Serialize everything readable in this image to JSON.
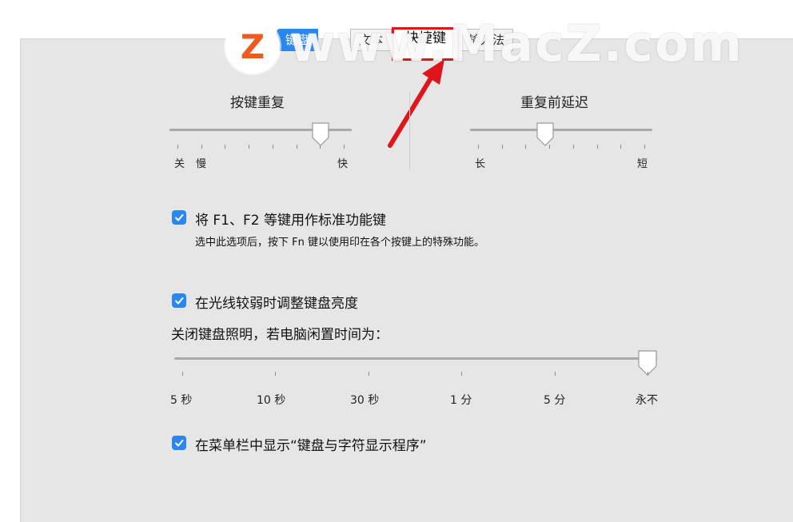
{
  "tabs": [
    {
      "label": "键盘"
    },
    {
      "label": "文本"
    },
    {
      "label": "快捷键"
    },
    {
      "label": "输入法"
    }
  ],
  "watermark": {
    "logo_letter": "Z",
    "text": "www.MacZ.com"
  },
  "key_repeat": {
    "heading": "按键重复",
    "labels": {
      "off": "关",
      "slow": "慢",
      "fast": "快"
    },
    "value_fraction": 0.83
  },
  "delay_until_repeat": {
    "heading": "重复前延迟",
    "labels": {
      "long": "长",
      "short": "短"
    },
    "value_fraction": 0.41
  },
  "options": {
    "fn_keys": {
      "checked": true,
      "label": "将 F1、F2 等键用作标准功能键",
      "note": "选中此选项后，按下 Fn 键以使用印在各个按键上的特殊功能。"
    },
    "adjust_brightness": {
      "checked": true,
      "label": "在光线较弱时调整键盘亮度"
    },
    "backlight_off_label": "关闭键盘照明，若电脑闲置时间为：",
    "show_viewer": {
      "checked": true,
      "label": "在菜单栏中显示“键盘与字符显示程序”"
    }
  },
  "backlight_slider": {
    "stops": [
      "5 秒",
      "10 秒",
      "30 秒",
      "1 分",
      "5 分",
      "永不"
    ],
    "selected": "永不"
  },
  "colors": {
    "accent": "#2b87f0",
    "highlight": "#e0151b",
    "panel": "#e6e6e6"
  }
}
